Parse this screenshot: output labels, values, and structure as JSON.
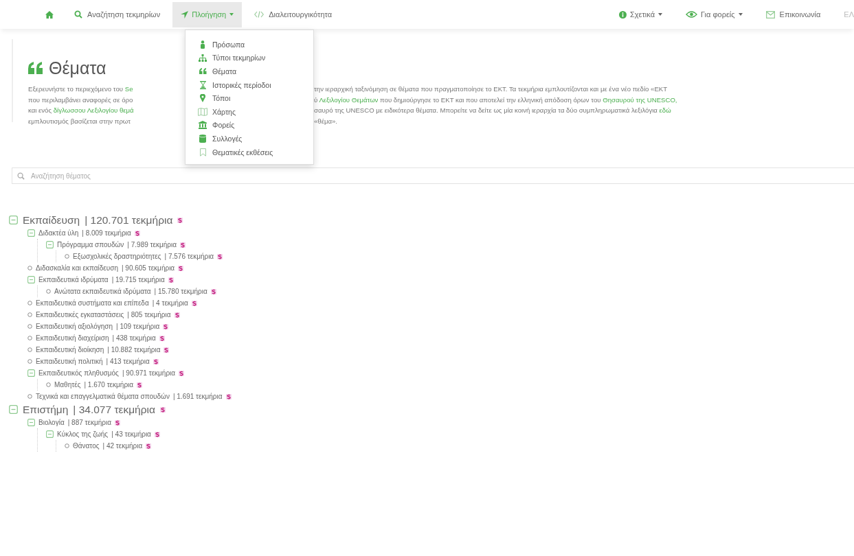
{
  "nav": {
    "left": [
      {
        "kind": "home",
        "selected": false,
        "dropdown": false
      },
      {
        "kind": "search",
        "label": "Αναζήτηση τεκμηρίων",
        "selected": false,
        "dropdown": false
      },
      {
        "kind": "navigate",
        "label": "Πλοήγηση",
        "selected": true,
        "dropdown": true
      },
      {
        "kind": "code",
        "label": "Διαλειτουργικότητα",
        "selected": false,
        "dropdown": false
      }
    ],
    "right": [
      {
        "kind": "info",
        "label": "Σχετικά",
        "selected": false,
        "dropdown": true
      },
      {
        "kind": "eye",
        "label": "Για φορείς",
        "selected": false,
        "dropdown": true
      },
      {
        "kind": "mail",
        "label": "Επικοινωνία",
        "selected": false,
        "dropdown": false
      },
      {
        "kind": "text",
        "label": "ΕΛ",
        "selected": false,
        "dropdown": false
      }
    ]
  },
  "menu": [
    {
      "kind": "person",
      "label": "Πρόσωπα"
    },
    {
      "kind": "tree",
      "label": "Τύποι τεκμηρίων"
    },
    {
      "kind": "quote",
      "label": "Θέματα"
    },
    {
      "kind": "hourglass",
      "label": "Ιστορικές περίοδοι"
    },
    {
      "kind": "pin",
      "label": "Τόποι"
    },
    {
      "kind": "map",
      "label": "Χάρτης"
    },
    {
      "kind": "bank",
      "label": "Φορείς"
    },
    {
      "kind": "database",
      "label": "Συλλογές"
    },
    {
      "kind": "bookmark",
      "label": "Θεματικές εκθέσεις"
    }
  ],
  "heading": "Θέματα",
  "intro": [
    {
      "left": [
        {
          "text": "Εξερευνήστε το περιεχόμενο του ",
          "link": false
        },
        {
          "text": "Se",
          "link": true
        }
      ],
      "right": [
        {
          "text": "την ιεραρχική ταξινόμηση σε θέματα που πραγματοποίησε το ΕΚΤ. Τα τεκμήρια εμπλουτίζονται και με ένα νέο πεδίο «ΕΚΤ",
          "link": false
        }
      ]
    },
    {
      "left": [
        {
          "text": "που περιλαμβάνει αναφορές σε όρο",
          "link": false
        }
      ],
      "right": [
        {
          "text": "ύ ",
          "link": false
        },
        {
          "text": "Λεξιλογίου Θεμάτων",
          "link": true
        },
        {
          "text": " που δημιούργησε το ΕΚΤ και που αποτελεί την ελληνική απόδοση όρων του ",
          "link": false
        },
        {
          "text": "Θησαυρού της UNESCO,",
          "link": true
        }
      ]
    },
    {
      "left": [
        {
          "text": "και ενός ",
          "link": false
        },
        {
          "text": "δίγλωσσου Λεξιλογίου θεμά",
          "link": true
        }
      ],
      "right": [
        {
          "text": "σαυρό της UNESCO με ειδικότερα θέματα. Μπορείτε να δείτε ως μία κοινή ιεραρχία τα δύο συμπληρωματικά λεξιλόγια ",
          "link": false
        },
        {
          "text": "εδώ",
          "link": true
        }
      ]
    },
    {
      "left": [
        {
          "text": "εμπλουτισμός βασίζεται στην πρωτ",
          "link": false
        }
      ],
      "right": [
        {
          "text": "«θέμα».",
          "link": false
        }
      ]
    }
  ],
  "search": {
    "placeholder": "Αναζήτηση θέματος"
  },
  "tree": [
    {
      "label": "Εκπαίδευση",
      "count": "| 120.701 τεκμήρια",
      "expanded": true,
      "children": [
        {
          "label": "Διδακτέα ύλη",
          "count": "| 8.009 τεκμήρια",
          "expanded": true,
          "children": [
            {
              "label": "Πρόγραμμα σπουδών",
              "count": "| 7.989 τεκμήρια",
              "expanded": true,
              "children": [
                {
                  "label": "Εξωσχολικές δραστηριότητες",
                  "count": "| 7.576 τεκμήρια"
                }
              ]
            }
          ]
        },
        {
          "label": "Διδασκαλία και εκπαίδευση",
          "count": "| 90.605 τεκμήρια"
        },
        {
          "label": "Εκπαιδευτικά ιδρύματα",
          "count": "| 19.715 τεκμήρια",
          "expanded": true,
          "children": [
            {
              "label": "Ανώτατα εκπαιδευτικά ιδρύματα",
              "count": "| 15.780 τεκμήρια"
            }
          ]
        },
        {
          "label": "Εκπαιδευτικά συστήματα και επίπεδα",
          "count": "| 4 τεκμήρια"
        },
        {
          "label": "Εκπαιδευτικές εγκαταστάσεις",
          "count": "| 805 τεκμήρια"
        },
        {
          "label": "Εκπαιδευτική αξιολόγηση",
          "count": "| 109 τεκμήρια"
        },
        {
          "label": "Εκπαιδευτική διαχείριση",
          "count": "| 438 τεκμήρια"
        },
        {
          "label": "Εκπαιδευτική διοίκηση",
          "count": "| 10.882 τεκμήρια"
        },
        {
          "label": "Εκπαιδευτική πολιτική",
          "count": "| 413 τεκμήρια"
        },
        {
          "label": "Εκπαιδευτικός πληθυσμός",
          "count": "| 90.971 τεκμήρια",
          "expanded": true,
          "children": [
            {
              "label": "Μαθητές",
              "count": "| 1.670 τεκμήρια"
            }
          ]
        },
        {
          "label": "Τεχνικά και επαγγελματικά θέματα σπουδών",
          "count": "| 1.691 τεκμήρια"
        }
      ]
    },
    {
      "label": "Επιστήμη",
      "count": "| 34.077 τεκμήρια",
      "expanded": true,
      "children": [
        {
          "label": "Βιολογία",
          "count": "| 887 τεκμήρια",
          "expanded": true,
          "children": [
            {
              "label": "Κύκλος της ζωής",
              "count": "| 43 τεκμήρια",
              "expanded": true,
              "children": [
                {
                  "label": "Θάνατος",
                  "count": "| 42 τεκμήρια"
                }
              ]
            }
          ]
        }
      ]
    }
  ]
}
